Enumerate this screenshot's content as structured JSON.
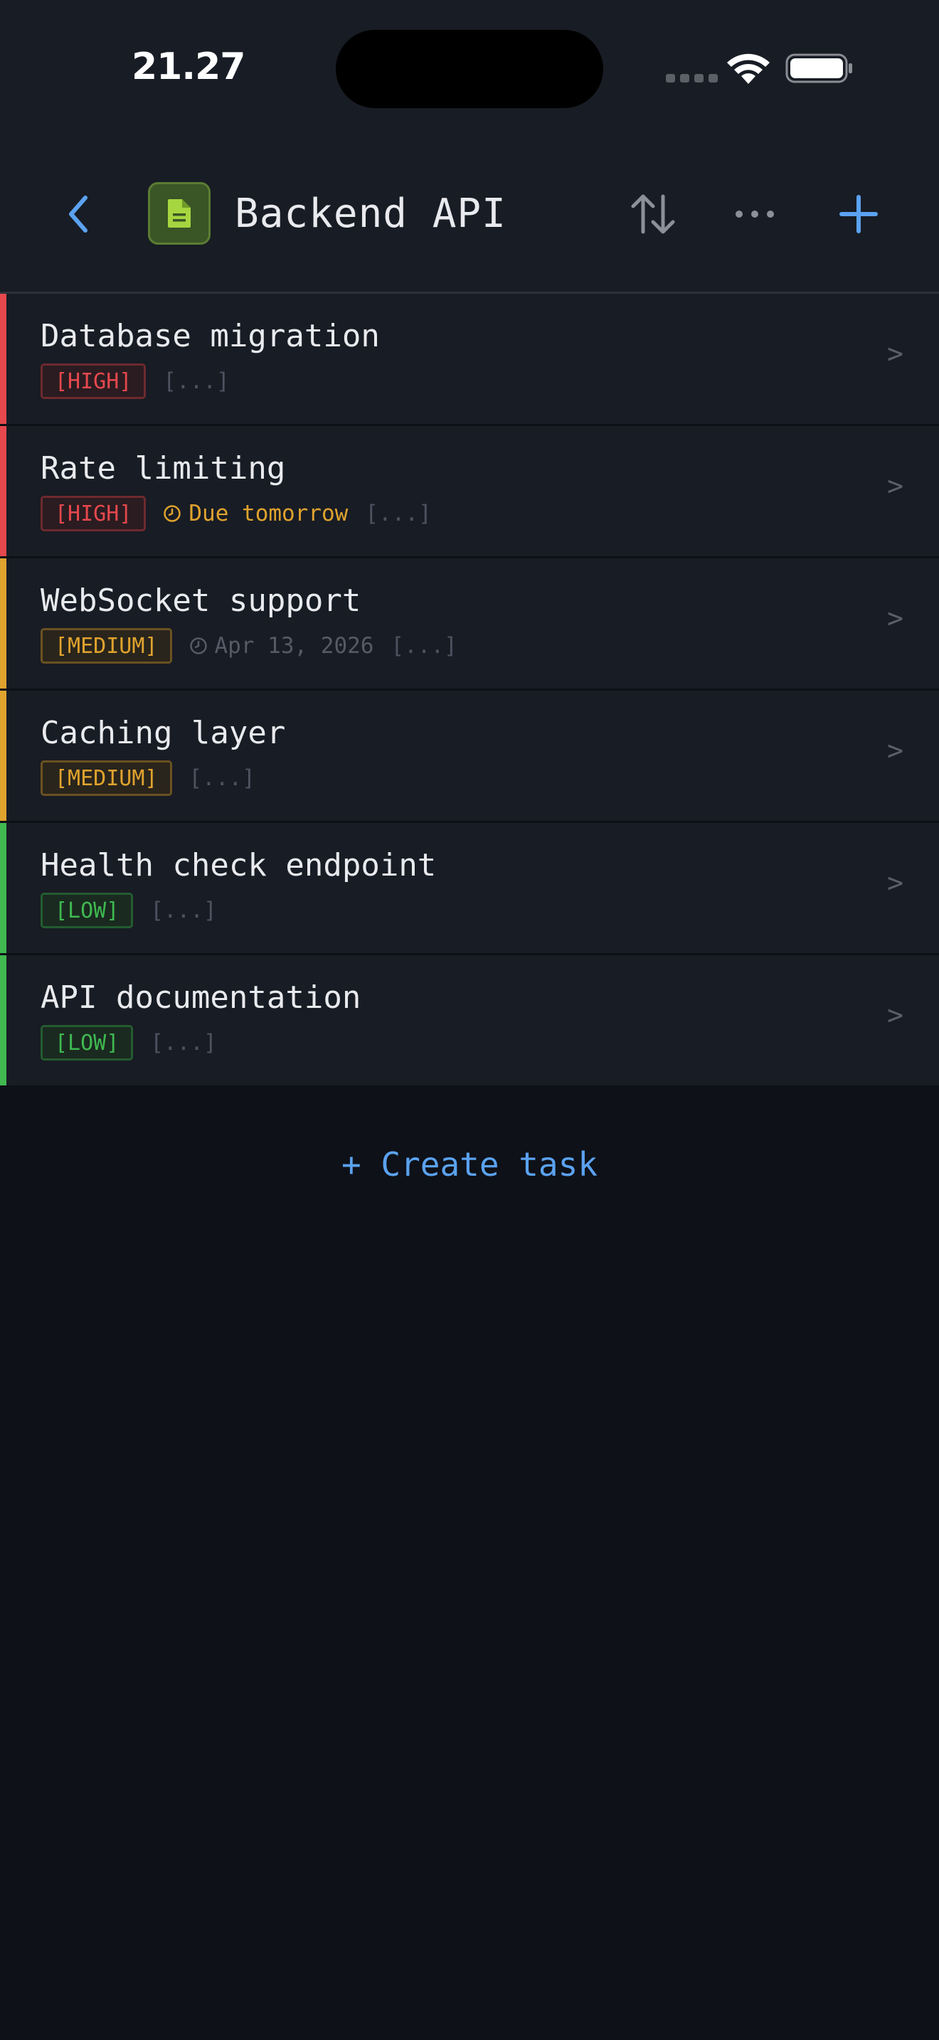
{
  "status_bar": {
    "time": "21.27"
  },
  "header": {
    "title": "Backend API",
    "icons": {
      "back": "chevron-left-icon",
      "project": "document-icon",
      "sort": "sort-arrows-icon",
      "more": "ellipsis-icon",
      "add": "plus-icon"
    }
  },
  "colors": {
    "accent": "#5ba2f0",
    "high": "#e5484d",
    "medium": "#e0a32e",
    "low": "#3fb950",
    "project_icon": "#a5d63f"
  },
  "tasks": [
    {
      "title": "Database migration",
      "priority": "[HIGH]",
      "priority_level": "high",
      "due": "",
      "more": "[...]",
      "chevron": ">"
    },
    {
      "title": "Rate limiting",
      "priority": "[HIGH]",
      "priority_level": "high",
      "due": "Due tomorrow",
      "due_style": "warning",
      "more": "[...]",
      "chevron": ">"
    },
    {
      "title": "WebSocket support",
      "priority": "[MEDIUM]",
      "priority_level": "medium",
      "due": "Apr 13, 2026",
      "due_style": "muted",
      "more": "[...]",
      "chevron": ">"
    },
    {
      "title": "Caching layer",
      "priority": "[MEDIUM]",
      "priority_level": "medium",
      "due": "",
      "more": "[...]",
      "chevron": ">"
    },
    {
      "title": "Health check endpoint",
      "priority": "[LOW]",
      "priority_level": "low",
      "due": "",
      "more": "[...]",
      "chevron": ">"
    },
    {
      "title": "API documentation",
      "priority": "[LOW]",
      "priority_level": "low",
      "due": "",
      "more": "[...]",
      "chevron": ">"
    }
  ],
  "create_task_label": "+ Create task"
}
